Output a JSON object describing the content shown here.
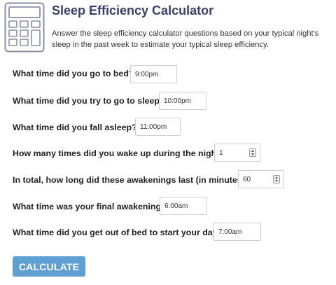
{
  "header": {
    "title": "Sleep Efficiency Calculator",
    "description": "Answer the sleep efficiency calculator questions based on your typical night's sleep in the past week to estimate your typical sleep efficiency.",
    "icon": "calculator-icon"
  },
  "questions": [
    {
      "label": "What time did you go to bed?",
      "value": "9:00pm",
      "type": "time"
    },
    {
      "label": "What time did you try to go to sleep?",
      "value": "10:00pm",
      "type": "time"
    },
    {
      "label": "What time did you fall asleep?",
      "value": "11:00pm",
      "type": "time"
    },
    {
      "label": "How many times did you wake up during the night?",
      "value": "1",
      "type": "number"
    },
    {
      "label": "In total, how long did these awakenings last (in minutes)?",
      "value": "60",
      "type": "number"
    },
    {
      "label": "What time was your final awakening?",
      "value": "6:00am",
      "type": "time"
    },
    {
      "label": "What time did you get out of bed to start your day?",
      "value": "7:00am",
      "type": "time"
    }
  ],
  "actions": {
    "calculate_label": "CALCULATE"
  },
  "colors": {
    "title": "#3a3f69",
    "button": "#5f9fd1",
    "icon_stroke": "#8a8fa5"
  }
}
